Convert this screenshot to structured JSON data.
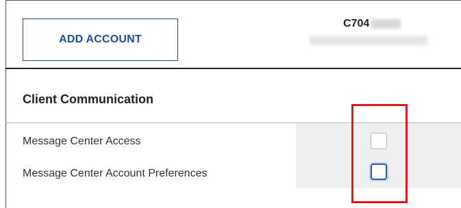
{
  "toolbar": {
    "add_account_label": "ADD ACCOUNT"
  },
  "account": {
    "id_prefix": "C704"
  },
  "section": {
    "title": "Client Communication"
  },
  "rows": [
    {
      "label": "Message Center Access",
      "checked": false
    },
    {
      "label": "Message Center Account Preferences",
      "checked": false
    }
  ],
  "colors": {
    "accent": "#1f4e96",
    "highlight": "#e0191e",
    "shade": "#efefef"
  }
}
